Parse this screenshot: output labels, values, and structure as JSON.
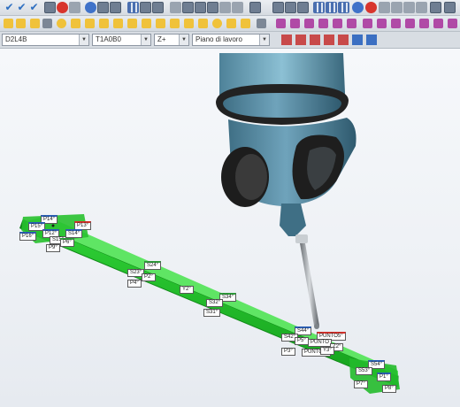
{
  "toolbar": {
    "combo_alignment": "D2L4B",
    "combo_tool": "T1A0B0",
    "combo_direction": "Z+",
    "combo_plane": "Piano di lavoro"
  },
  "labels": {
    "p14": "P14°",
    "p15": "P15°",
    "p16": "P16°",
    "p13": "P13°",
    "p12": "P12°",
    "s14": "S14°",
    "s15": "S15°",
    "p6": "P6°",
    "p9": "P9°",
    "s24": "S24°",
    "s23": "S23°",
    "p2": "P2°",
    "p4": "P4°",
    "y2": "Y2°",
    "s34": "S34°",
    "s32": "S32°",
    "s31": "S31°",
    "s44": "S44°",
    "s42": "S42°",
    "p5": "P5°",
    "punto5": "PUNTO5°",
    "puntoa": "PUNTO",
    "z2": "Z2°",
    "p3": "P3°",
    "punto2": "PUNTO2°",
    "y3": "Y3°",
    "s54": "S54°",
    "s53": "S53°",
    "p1": "P1°",
    "p7": "P7°",
    "p8": "P8°"
  },
  "colors": {
    "bar": "#22c32a",
    "probe": "#5c8fa8",
    "background": "#eef1f5"
  }
}
